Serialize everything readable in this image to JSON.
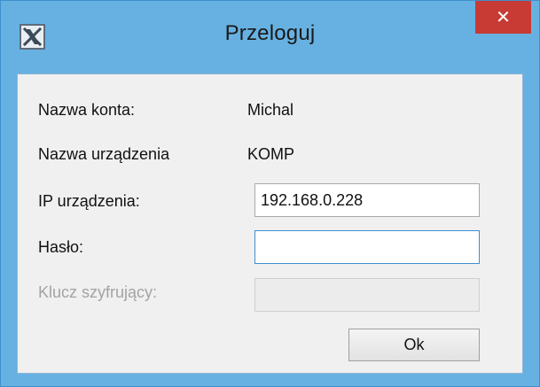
{
  "window": {
    "title": "Przeloguj",
    "app_icon": "x-box-icon",
    "close_icon": "close-icon",
    "close_label": "✕"
  },
  "form": {
    "account_label": "Nazwa konta:",
    "account_value": "Michal",
    "device_name_label": "Nazwa urządzenia",
    "device_name_value": "KOMP",
    "device_ip_label": "IP urządzenia:",
    "device_ip_value": "192.168.0.228",
    "password_label": "Hasło:",
    "password_value": "",
    "encryption_key_label": "Klucz szyfrujący:",
    "encryption_key_value": ""
  },
  "buttons": {
    "ok_label": "Ok"
  },
  "colors": {
    "frame": "#67b1e2",
    "close_button": "#c73b34",
    "client_bg": "#f0f0f0"
  }
}
